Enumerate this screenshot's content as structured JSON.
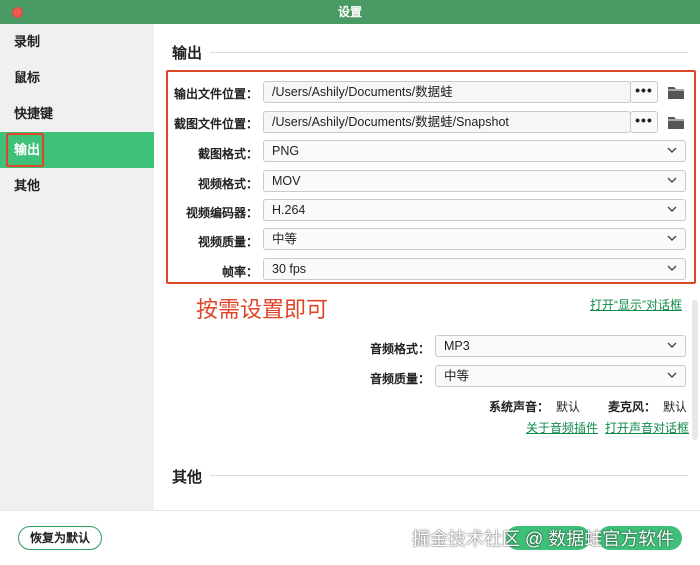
{
  "window": {
    "title": "设置"
  },
  "sidebar": {
    "items": [
      {
        "label": "录制"
      },
      {
        "label": "鼠标"
      },
      {
        "label": "快捷键"
      },
      {
        "label": "输出"
      },
      {
        "label": "其他"
      }
    ],
    "active_index": 3
  },
  "output": {
    "section_title": "输出",
    "output_path": {
      "label": "输出文件位置：",
      "value": "/Users/Ashily/Documents/数据蛙"
    },
    "snapshot_path": {
      "label": "截图文件位置：",
      "value": "/Users/Ashily/Documents/数据蛙/Snapshot"
    },
    "screenshot_format": {
      "label": "截图格式：",
      "value": "PNG"
    },
    "video_format": {
      "label": "视频格式：",
      "value": "MOV"
    },
    "video_encoder": {
      "label": "视频编码器：",
      "value": "H.264"
    },
    "video_quality": {
      "label": "视频质量：",
      "value": "中等"
    },
    "frame_rate": {
      "label": "帧率：",
      "value": "30 fps"
    },
    "browse_label": "•••",
    "annotation": "按需设置即可",
    "display_dialog_link": "打开“显示”对话框",
    "audio_format": {
      "label": "音频格式：",
      "value": "MP3"
    },
    "audio_quality": {
      "label": "音频质量：",
      "value": "中等"
    },
    "system_sound": {
      "label": "系统声音：",
      "value": "默认"
    },
    "microphone": {
      "label": "麦克风：",
      "value": "默认"
    },
    "audio_plugin_link": "关于音频插件",
    "sound_dialog_link": "打开声音对话框"
  },
  "other": {
    "section_title": "其他"
  },
  "footer": {
    "reset_label": "恢复为默认",
    "watermark": "掘金技术社区 @ 数据蛙官方软件"
  },
  "colors": {
    "accent": "#3ec079",
    "titlebar": "#4a9a63",
    "highlight": "#e0452a",
    "link": "#0e8a4a"
  }
}
